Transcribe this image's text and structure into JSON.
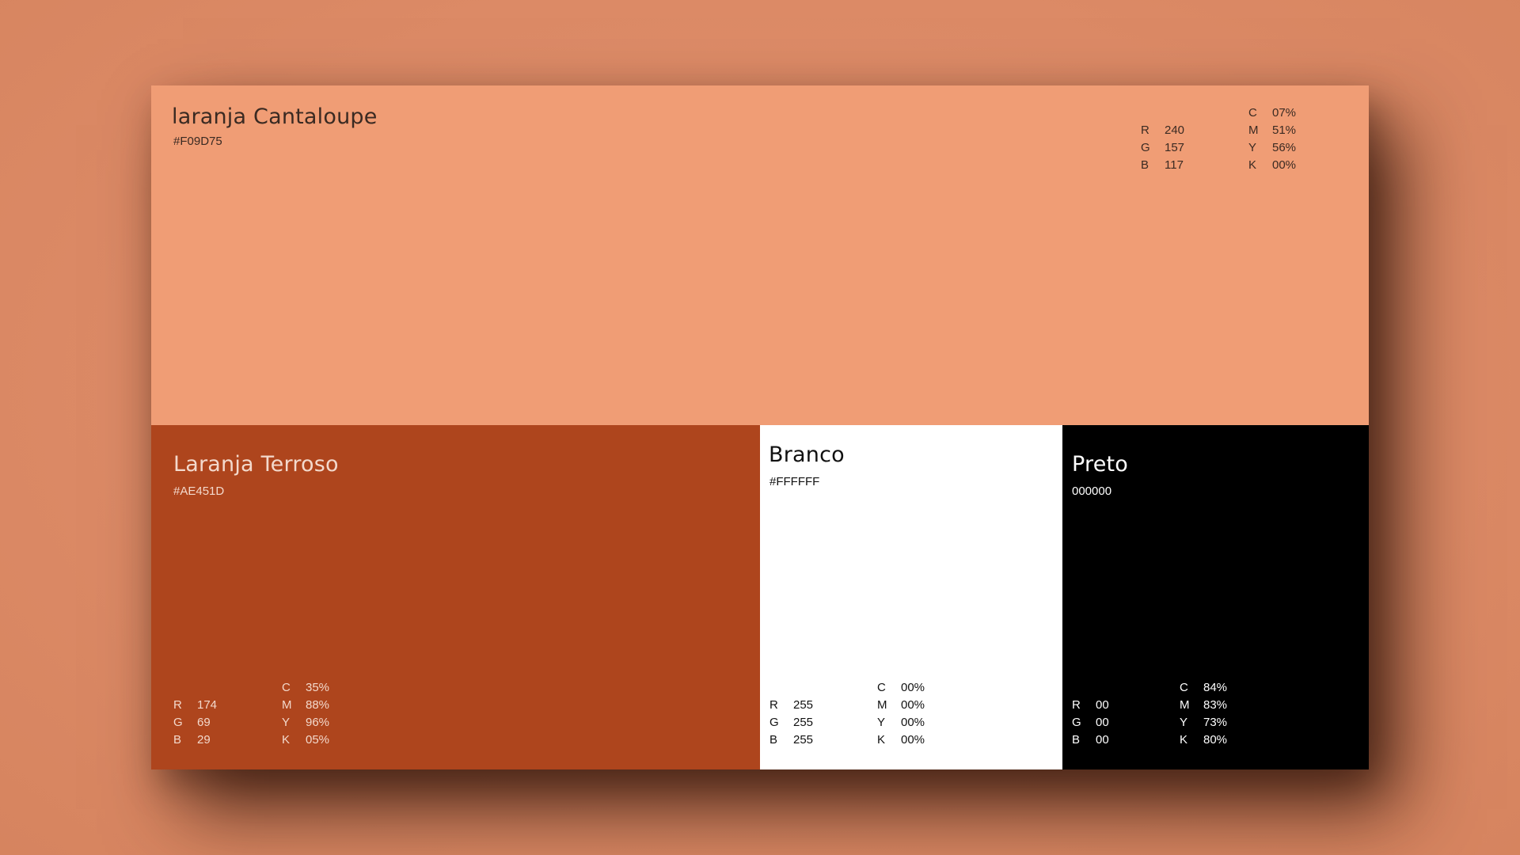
{
  "swatches": {
    "cantaloupe": {
      "name": "laranja Cantaloupe",
      "hex": "#F09D75",
      "bg": "#F09D75",
      "text_color": "#3a2a22",
      "rgb": [
        [
          "R",
          "240"
        ],
        [
          "G",
          "157"
        ],
        [
          "B",
          "117"
        ]
      ],
      "cmyk": [
        [
          "C",
          "07%"
        ],
        [
          "M",
          "51%"
        ],
        [
          "Y",
          "56%"
        ],
        [
          "K",
          "00%"
        ]
      ]
    },
    "terroso": {
      "name": "Laranja Terroso",
      "hex": "#AE451D",
      "bg": "#AE451D",
      "text_color": "#f3d9cc",
      "rgb": [
        [
          "R",
          "174"
        ],
        [
          "G",
          "69"
        ],
        [
          "B",
          "29"
        ]
      ],
      "cmyk": [
        [
          "C",
          "35%"
        ],
        [
          "M",
          "88%"
        ],
        [
          "Y",
          "96%"
        ],
        [
          "K",
          "05%"
        ]
      ]
    },
    "branco": {
      "name": "Branco",
      "hex": "#FFFFFF",
      "bg": "#FFFFFF",
      "text_color": "#111111",
      "rgb": [
        [
          "R",
          "255"
        ],
        [
          "G",
          "255"
        ],
        [
          "B",
          "255"
        ]
      ],
      "cmyk": [
        [
          "C",
          "00%"
        ],
        [
          "M",
          "00%"
        ],
        [
          "Y",
          "00%"
        ],
        [
          "K",
          "00%"
        ]
      ]
    },
    "preto": {
      "name": "Preto",
      "hex": "000000",
      "bg": "#000000",
      "text_color": "#ffffff",
      "rgb": [
        [
          "R",
          "00"
        ],
        [
          "G",
          "00"
        ],
        [
          "B",
          "00"
        ]
      ],
      "cmyk": [
        [
          "C",
          "84%"
        ],
        [
          "M",
          "83%"
        ],
        [
          "Y",
          "73%"
        ],
        [
          "K",
          "80%"
        ]
      ]
    }
  }
}
